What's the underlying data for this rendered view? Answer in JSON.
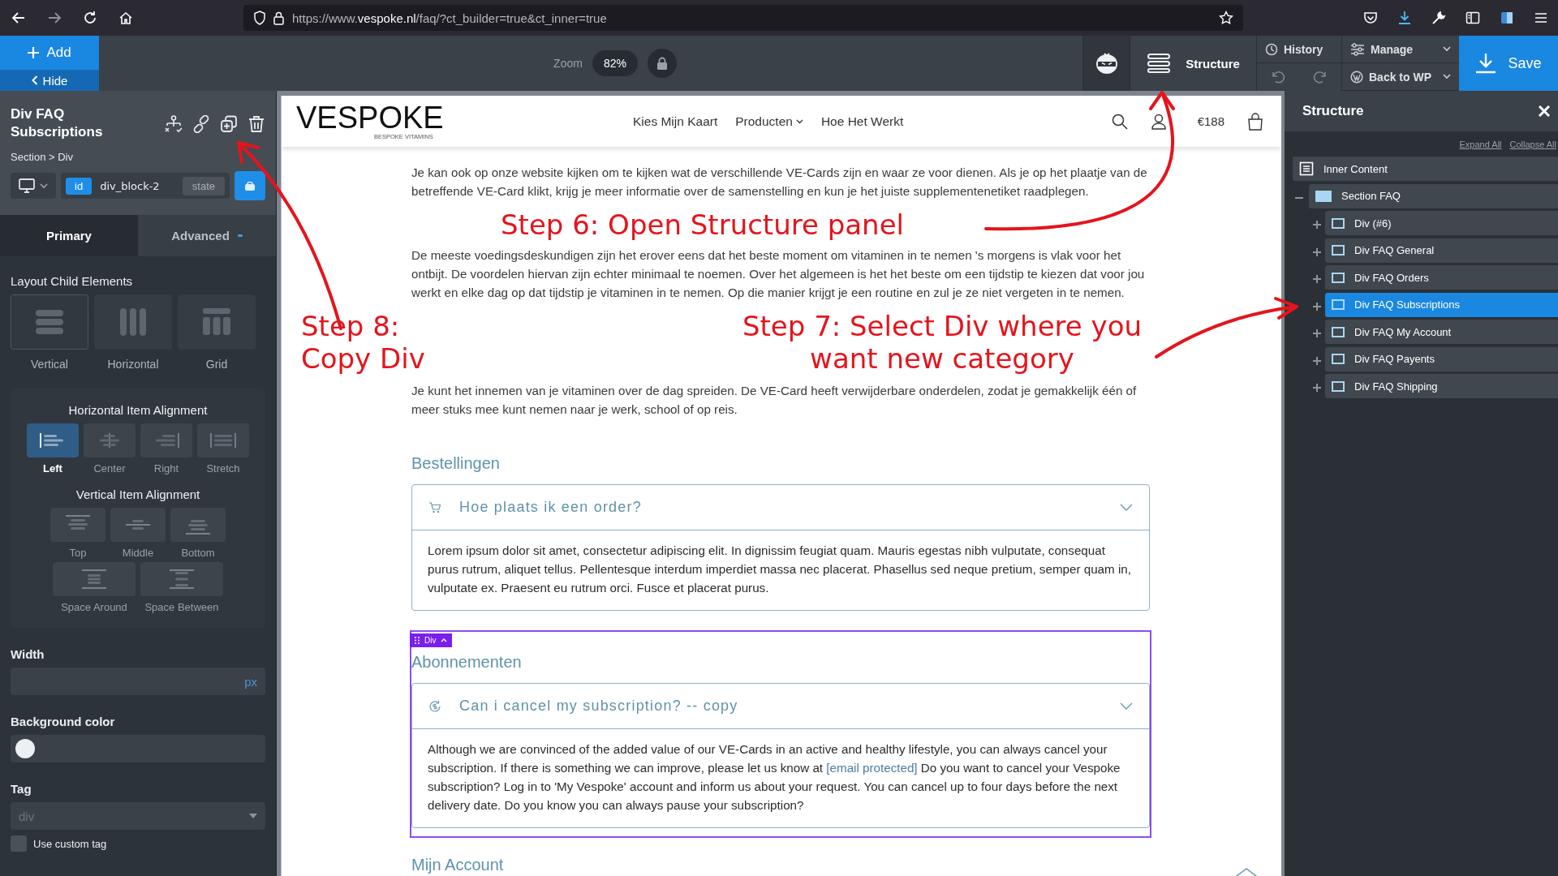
{
  "browser": {
    "url": "https://www.**vespoke.nl**/faq/?ct_builder=true&ct_inner=true"
  },
  "toolbar": {
    "add": "Add",
    "hide": "Hide",
    "zoom_label": "Zoom",
    "zoom_value": "82%",
    "structure": "Structure",
    "history": "History",
    "manage": "Manage",
    "back": "Back to WP",
    "save": "Save"
  },
  "properties": {
    "title": "Div FAQ Subscriptions",
    "breadcrumb": "Section > Div",
    "id_badge": "id",
    "selector": "div_block-2",
    "state": "state",
    "tabs": [
      {
        "label": "Primary",
        "selected": true
      },
      {
        "label": "Advanced",
        "selected": false
      }
    ],
    "layout_title": "Layout Child Elements",
    "layout_options": [
      {
        "label": "Vertical",
        "selected": true
      },
      {
        "label": "Horizontal",
        "selected": false
      },
      {
        "label": "Grid",
        "selected": false
      }
    ],
    "h_align_title": "Horizontal Item Alignment",
    "h_align": [
      {
        "label": "Left",
        "selected": true
      },
      {
        "label": "Center",
        "selected": false
      },
      {
        "label": "Right",
        "selected": false
      },
      {
        "label": "Stretch",
        "selected": false
      }
    ],
    "v_align_title": "Vertical Item Alignment",
    "v_align": [
      {
        "label": "Top",
        "selected": false
      },
      {
        "label": "Middle",
        "selected": false
      },
      {
        "label": "Bottom",
        "selected": false
      },
      {
        "label": "Space Around",
        "selected": false
      },
      {
        "label": "Space Between",
        "selected": false
      }
    ],
    "width_label": "Width",
    "width_unit": "px",
    "background_label": "Background color",
    "tag_label": "Tag",
    "tag_value": "div",
    "custom_tag": {
      "label": "Use custom tag",
      "checked": false
    }
  },
  "canvas": {
    "logo": "VESPOKE",
    "tagline": "BESPOKE VITAMINS",
    "nav": [
      {
        "label": "Kies Mijn Kaart",
        "dropdown": false
      },
      {
        "label": "Producten",
        "dropdown": true
      },
      {
        "label": "Hoe Het Werkt",
        "dropdown": false
      }
    ],
    "cart_total": "€188",
    "paragraphs": [
      "Je kan ook op onze website kijken om te kijken wat de verschillende VE-Cards zijn en waar ze voor dienen. Als je op het plaatje van de betreffende VE-Card klikt, krijg je meer informatie over de samenstelling en kun je het juiste supplementenetiket raadplegen.",
      "De meeste voedingsdeskundigen zijn het erover eens dat het beste moment om vitaminen in te nemen 's morgens is vlak voor het ontbijt. De voordelen hiervan zijn echter minimaal te noemen. Over het algemeen is het het beste om een tijdstip te kiezen dat voor jou werkt en elke dag op dat tijdstip je vitaminen in te nemen. Op die manier krijgt je een routine en zul je ze niet vergeten in te nemen.",
      "Je kunt het innemen van je vitaminen over de dag spreiden. De VE-Card heeft verwijderbare onderdelen, zodat je gemakkelijk één of meer stuks mee kunt nemen naar je werk, school of op reis."
    ],
    "selection_label": "Div",
    "sections": [
      {
        "heading": "Bestellingen",
        "selected": false,
        "question": "Hoe plaats ik een order?",
        "answer": [
          {
            "kind": "text",
            "text": "Lorem ipsum dolor sit amet, consectetur adipiscing elit. In dignissim feugiat quam. Mauris egestas nibh vulputate, consequat purus rutrum, aliquet tellus. Pellentesque interdum imperdiet massa nec placerat. Phasellus sed neque pretium, semper quam in, vulputate ex. Praesent eu rutrum orci. Fusce et placerat purus."
          }
        ]
      },
      {
        "heading": "Abonnementen",
        "selected": true,
        "question": "Can i cancel my subscription? -- copy",
        "answer": [
          {
            "kind": "text",
            "text": "Although we are convinced of the added value of our VE-Cards in an active and healthy lifestyle, you can always cancel your subscription. If there is something we can improve, please let us know at "
          },
          {
            "kind": "link",
            "text": "[email protected]"
          },
          {
            "kind": "text",
            "text": " Do you want to cancel your Vespoke subscription? Log in to 'My Vespoke' account and inform us about your request. You can cancel up to four days before the next delivery date. Do you know you can always pause your subscription?"
          }
        ]
      }
    ],
    "next_heading": "Mijn Account"
  },
  "structure": {
    "title": "Structure",
    "expand_all": "Expand All",
    "collapse_all": "Collapse All",
    "tree": [
      {
        "label": "Inner Content",
        "selected": false,
        "children": [
          {
            "label": "Section FAQ",
            "selected": false,
            "expanded": true,
            "children": [
              {
                "label": "Div (#6)",
                "selected": false,
                "expanded": false
              },
              {
                "label": "Div FAQ General",
                "selected": false,
                "expanded": false
              },
              {
                "label": "Div FAQ Orders",
                "selected": false,
                "expanded": false
              },
              {
                "label": "Div FAQ Subscriptions",
                "selected": true,
                "expanded": false
              },
              {
                "label": "Div FAQ My Account",
                "selected": false,
                "expanded": false
              },
              {
                "label": "Div FAQ Payents",
                "selected": false,
                "expanded": false
              },
              {
                "label": "Div FAQ Shipping",
                "selected": false,
                "expanded": false
              }
            ]
          }
        ]
      }
    ]
  },
  "annotations": [
    {
      "text": "Step 6: Open Structure panel"
    },
    {
      "text": "Step 7: Select Div where you"
    },
    {
      "text": "want new category"
    },
    {
      "text": "Step 8:"
    },
    {
      "text": "Copy Div"
    }
  ]
}
